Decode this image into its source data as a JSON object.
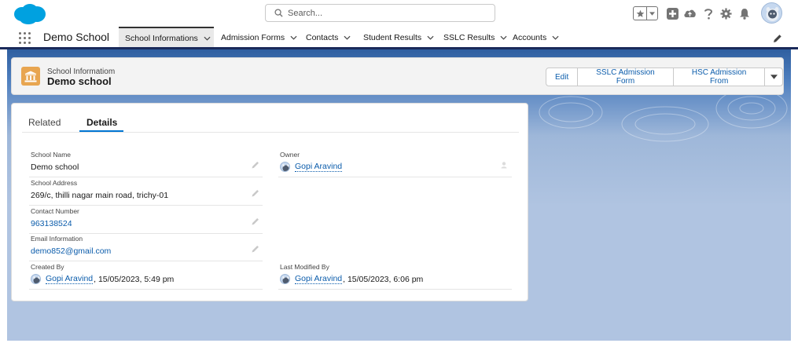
{
  "header": {
    "search_placeholder": "Search...",
    "icons": [
      "salesforce-cloud-logo",
      "search-icon",
      "favorites-star-icon",
      "chevron-down-icon",
      "global-actions-add-icon",
      "trailhead-icon",
      "help-icon",
      "setup-gear-icon",
      "notifications-bell-icon",
      "user-avatar"
    ]
  },
  "nav": {
    "app_name": "Demo School",
    "items": [
      {
        "label": "School Informations",
        "active": true
      },
      {
        "label": "Admission Forms"
      },
      {
        "label": "Contacts"
      },
      {
        "label": "Student Results"
      },
      {
        "label": "SSLC Results"
      },
      {
        "label": "Accounts"
      }
    ]
  },
  "record": {
    "type_label": "School Informatiom",
    "name": "Demo school",
    "actions": [
      "Edit",
      "SSLC Admission Form",
      "HSC Admission From"
    ]
  },
  "tabs": [
    "Related",
    "Details"
  ],
  "active_tab": "Details",
  "fields": {
    "school_name": {
      "label": "School Name",
      "value": "Demo school"
    },
    "school_address": {
      "label": "School Address",
      "value": "269/c, thilli nagar main road, trichy-01"
    },
    "contact_number": {
      "label": "Contact Number",
      "value": "963138524"
    },
    "email_information": {
      "label": "Email Information",
      "value": "demo852@gmail.com"
    },
    "created_by": {
      "label": "Created By",
      "user": "Gopi Aravind",
      "timestamp": ", 15/05/2023, 5:49 pm"
    },
    "owner": {
      "label": "Owner",
      "user": "Gopi Aravind"
    },
    "last_modified_by": {
      "label": "Last Modified By",
      "user": "Gopi Aravind",
      "timestamp": ", 15/05/2023, 6:06 pm"
    }
  },
  "colors": {
    "brand_blue": "#0176d3",
    "link_blue": "#0b5cab",
    "record_icon": "#e8a550",
    "salesforce_cloud": "#00a1e0",
    "page_background": "#b0c4e1"
  }
}
